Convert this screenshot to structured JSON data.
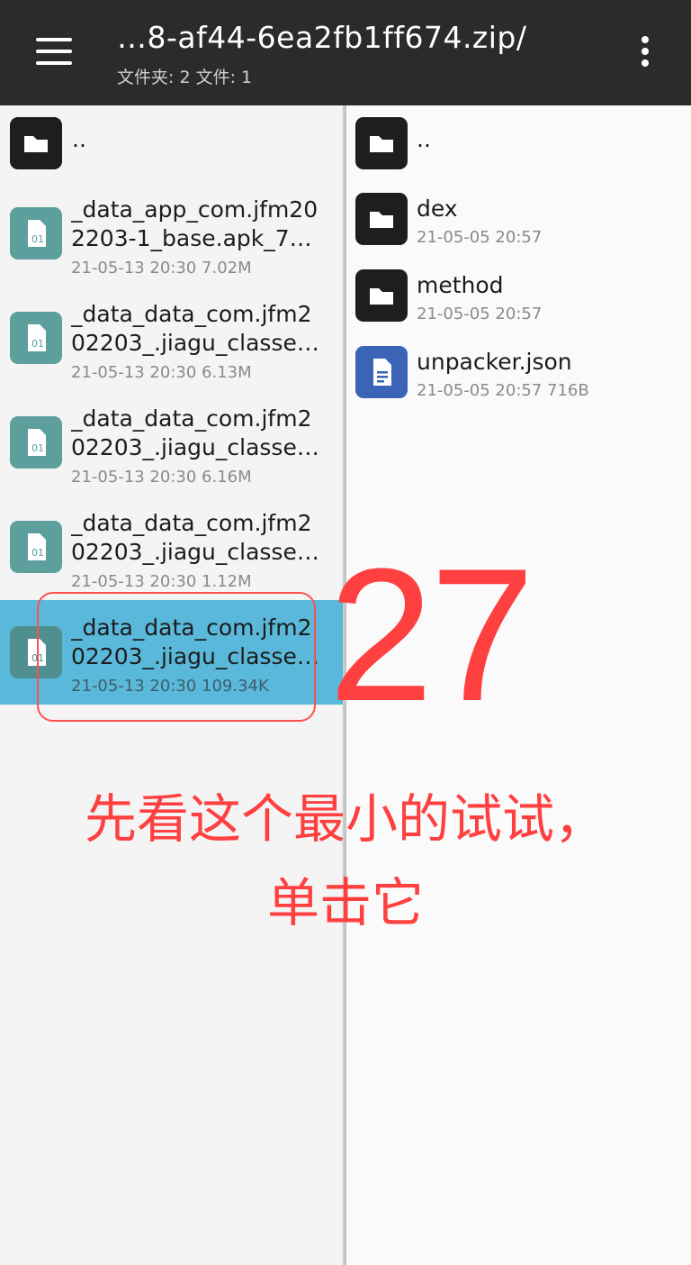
{
  "header": {
    "title": "…8-af44-6ea2fb1ff674.zip/",
    "subtitle": "文件夹: 2  文件: 1"
  },
  "left_pane": {
    "items": [
      {
        "name": "..",
        "type": "folder"
      },
      {
        "line1": "_data_app_com.jfm20",
        "line2": "2203-1_base.apk_7…",
        "meta": "21-05-13 20:30  7.02M",
        "type": "apk"
      },
      {
        "line1": "_data_data_com.jfm2",
        "line2": "02203_.jiagu_classe…",
        "meta": "21-05-13 20:30  6.13M",
        "type": "apk"
      },
      {
        "line1": "_data_data_com.jfm2",
        "line2": "02203_.jiagu_classe…",
        "meta": "21-05-13 20:30  6.16M",
        "type": "apk"
      },
      {
        "line1": "_data_data_com.jfm2",
        "line2": "02203_.jiagu_classe…",
        "meta": "21-05-13 20:30  1.12M",
        "type": "apk"
      },
      {
        "line1": "_data_data_com.jfm2",
        "line2": "02203_.jiagu_classe…",
        "meta": "21-05-13 20:30  109.34K",
        "type": "apk",
        "selected": true
      }
    ]
  },
  "right_pane": {
    "items": [
      {
        "name": "..",
        "type": "folder"
      },
      {
        "name": "dex",
        "meta": "21-05-05 20:57",
        "type": "folder"
      },
      {
        "name": "method",
        "meta": "21-05-05 20:57",
        "type": "folder"
      },
      {
        "name": "unpacker.json",
        "meta": "21-05-05 20:57  716B",
        "type": "doc"
      }
    ]
  },
  "annotation": {
    "step_number": "27",
    "line1": "先看这个最小的试试，",
    "line2": "单击它"
  },
  "colors": {
    "header_bg": "#2b2b2b",
    "selected_row": "#5ab9da",
    "annotation": "#ff4040",
    "apk_icon": "#5c9f9c",
    "doc_icon": "#3b64b6"
  }
}
